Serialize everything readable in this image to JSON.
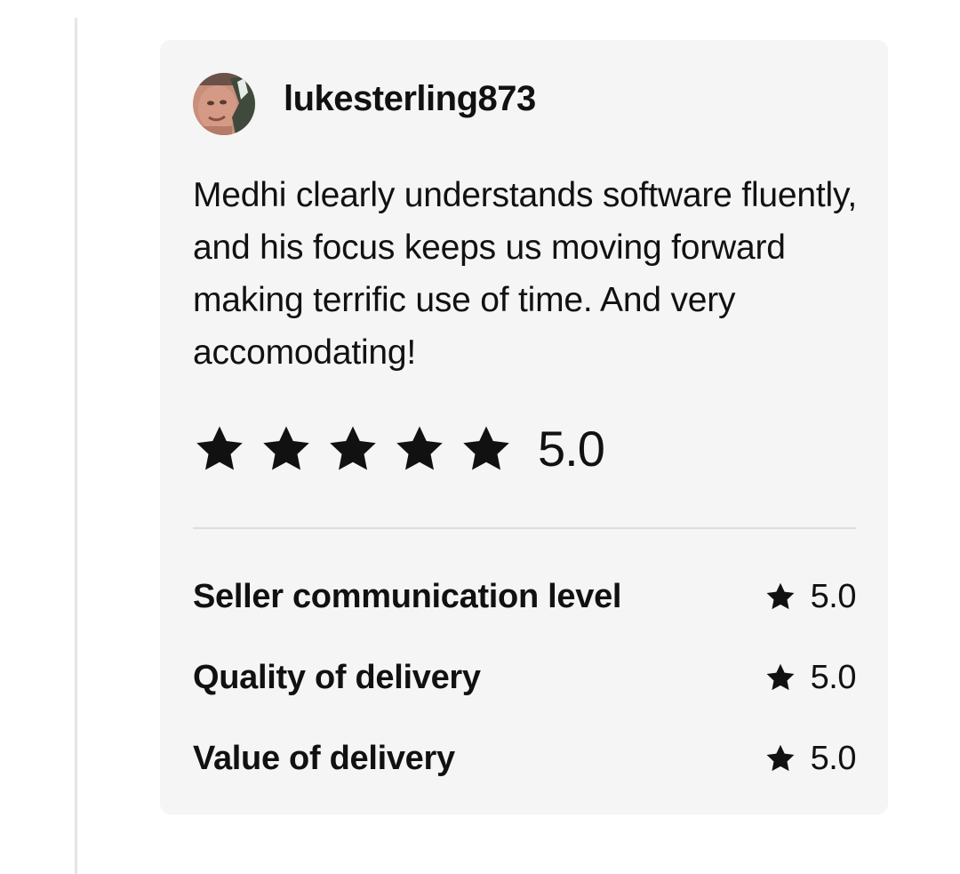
{
  "review": {
    "username": "lukesterling873",
    "text": "Medhi clearly understands software fluently, and his focus keeps us moving forward making terrific use of time. And very accomodating!",
    "rating": {
      "stars": 5,
      "max_stars": 5,
      "value_label": "5.0"
    },
    "criteria": [
      {
        "label": "Seller communication level",
        "value": "5.0"
      },
      {
        "label": "Quality of delivery",
        "value": "5.0"
      },
      {
        "label": "Value of delivery",
        "value": "5.0"
      }
    ]
  },
  "icons": {
    "star": "star-icon",
    "avatar": "avatar"
  },
  "colors": {
    "card_background": "#f5f5f5",
    "text": "#111111",
    "star": "#111111",
    "divider": "#dddddd"
  }
}
